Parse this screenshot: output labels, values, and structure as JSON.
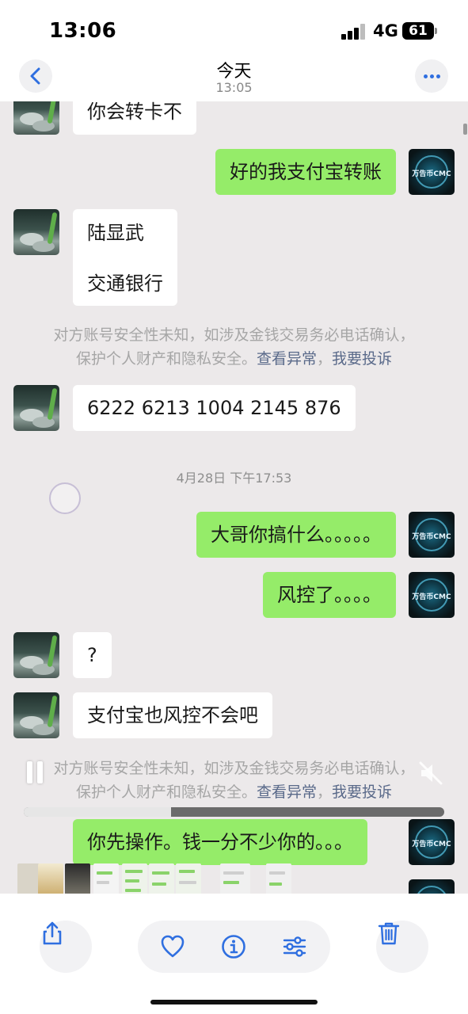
{
  "status_bar": {
    "time": "13:06",
    "network": "4G",
    "battery": "61",
    "icons": [
      "signal-bars-icon",
      "battery-icon"
    ]
  },
  "header": {
    "title": "今天",
    "subtitle": "13:05",
    "back_icon": "chevron-left-icon",
    "more_icon": "ellipsis-icon",
    "accent_color": "#2f6fe0"
  },
  "chat": {
    "sender_right_avatar_text": "万告币CMC",
    "bubble_colors": {
      "left": "#ffffff",
      "right": "#95ec69"
    },
    "messages": [
      {
        "side": "left",
        "text": "你会转卡不"
      },
      {
        "side": "right",
        "text": "好的我支付宝转账"
      },
      {
        "side": "left",
        "lines": [
          "陆显武",
          "交通银行"
        ]
      },
      {
        "side": "left",
        "text": "6222 6213 1004 2145 876"
      },
      {
        "side": "right",
        "text": "大哥你搞什么。。。。。"
      },
      {
        "side": "right",
        "text": "风控了。。。。"
      },
      {
        "side": "left",
        "text": "?"
      },
      {
        "side": "left",
        "text": "支付宝也风控不会吧"
      },
      {
        "side": "right",
        "text": "你先操作。钱一分不少你的。。。"
      }
    ],
    "security_notice": {
      "line1": "对方账号安全性未知，如涉及金钱交易务必电话确认，",
      "line2_prefix": "保护个人财产和隐私安全。",
      "link1": "查看异常",
      "separator": "，",
      "link2": "我要投诉"
    },
    "timestamp": "4月28日 下午17:53"
  },
  "video_overlay": {
    "progress": 0.35,
    "icons": [
      "pause-icon",
      "speaker-muted-icon"
    ]
  },
  "toolbar": {
    "icons": [
      "share-icon",
      "heart-icon",
      "info-icon",
      "adjust-sliders-icon",
      "trash-icon"
    ],
    "accent_color": "#2f6fe0"
  }
}
